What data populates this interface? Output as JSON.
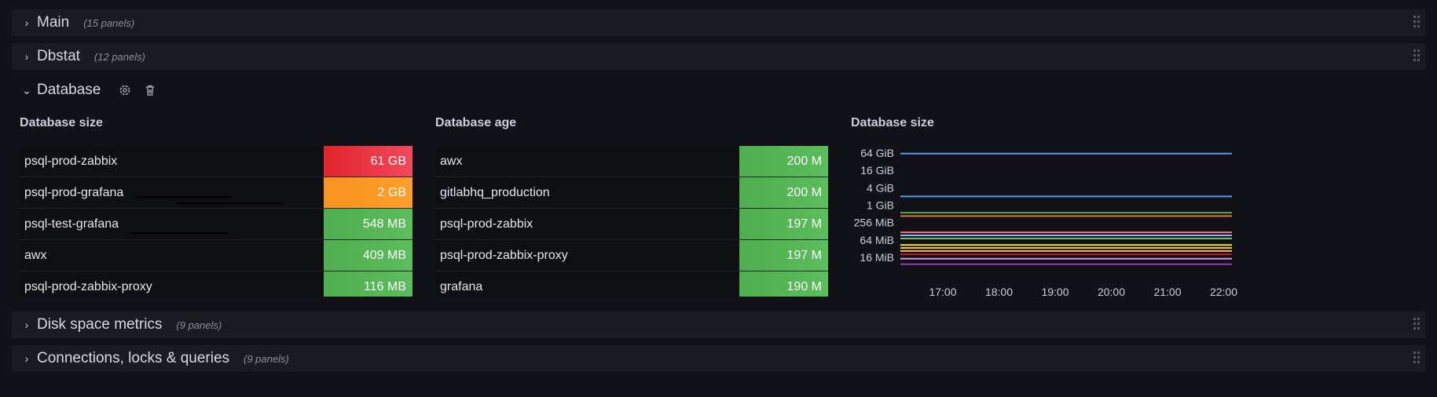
{
  "rows": {
    "main": {
      "title": "Main",
      "count": "(15 panels)"
    },
    "dbstat": {
      "title": "Dbstat",
      "count": "(12 panels)"
    },
    "database": {
      "title": "Database"
    },
    "disk": {
      "title": "Disk space metrics",
      "count": "(9 panels)"
    },
    "conn": {
      "title": "Connections, locks & queries",
      "count": "(9 panels)"
    }
  },
  "panels": {
    "size_table": {
      "title": "Database size",
      "rows": [
        {
          "name": "psql-prod-zabbix",
          "value": "61 GB",
          "color": "#e8303c"
        },
        {
          "name": "psql-prod-grafana",
          "value": "2 GB",
          "color": "#ff9830"
        },
        {
          "name": "psql-test-grafana",
          "value": "548 MB",
          "color": "#56b356"
        },
        {
          "name": "awx",
          "value": "409 MB",
          "color": "#56b356"
        },
        {
          "name": "psql-prod-zabbix-proxy",
          "value": "116 MB",
          "color": "#56b356"
        }
      ]
    },
    "age_table": {
      "title": "Database age",
      "rows": [
        {
          "name": "awx",
          "value": "200 M"
        },
        {
          "name": "gitlabhq_production",
          "value": "200 M"
        },
        {
          "name": "psql-prod-zabbix",
          "value": "197 M"
        },
        {
          "name": "psql-prod-zabbix-proxy",
          "value": "197 M"
        },
        {
          "name": "grafana",
          "value": "190 M"
        }
      ]
    },
    "size_chart": {
      "title": "Database size"
    }
  },
  "chart_data": {
    "type": "line",
    "title": "Database size",
    "y_ticks": [
      "64 GiB",
      "16 GiB",
      "4 GiB",
      "1 GiB",
      "256 MiB",
      "64 MiB",
      "16 MiB"
    ],
    "x_ticks": [
      "17:00",
      "18:00",
      "19:00",
      "20:00",
      "21:00",
      "22:00"
    ],
    "y_scale": "log",
    "series": [
      {
        "color": "#5794f2",
        "values_gib": [
          61,
          61,
          61,
          61,
          61,
          61
        ]
      },
      {
        "color": "#5794f2",
        "values_gib": [
          2,
          2,
          2,
          2,
          2,
          2
        ]
      },
      {
        "color": "#56a64b",
        "values_gib": [
          0.55,
          0.55,
          0.55,
          0.55,
          0.55,
          0.55
        ]
      },
      {
        "color": "#e0752d",
        "values_gib": [
          0.42,
          0.42,
          0.42,
          0.42,
          0.42,
          0.42
        ]
      },
      {
        "color": "#ff7383",
        "values_gib": [
          0.115,
          0.115,
          0.115,
          0.115,
          0.115,
          0.115
        ]
      },
      {
        "color": "#8ab8ff",
        "values_gib": [
          0.09,
          0.09,
          0.09,
          0.09,
          0.09,
          0.09
        ]
      },
      {
        "color": "#73bf69",
        "values_gib": [
          0.07,
          0.07,
          0.07,
          0.07,
          0.07,
          0.07
        ]
      },
      {
        "color": "#fade2a",
        "values_gib": [
          0.042,
          0.042,
          0.042,
          0.042,
          0.042,
          0.042
        ]
      },
      {
        "color": "#f2cc0c",
        "values_gib": [
          0.033,
          0.033,
          0.033,
          0.033,
          0.033,
          0.033
        ]
      },
      {
        "color": "#ffb357",
        "values_gib": [
          0.026,
          0.026,
          0.026,
          0.026,
          0.026,
          0.026
        ]
      },
      {
        "color": "#c4162a",
        "values_gib": [
          0.02,
          0.02,
          0.02,
          0.02,
          0.02,
          0.02
        ]
      },
      {
        "color": "#ca95e5",
        "values_gib": [
          0.014,
          0.014,
          0.014,
          0.014,
          0.014,
          0.014
        ]
      },
      {
        "color": "#8f3bb8",
        "values_gib": [
          0.009,
          0.009,
          0.009,
          0.009,
          0.009,
          0.009
        ]
      }
    ]
  }
}
